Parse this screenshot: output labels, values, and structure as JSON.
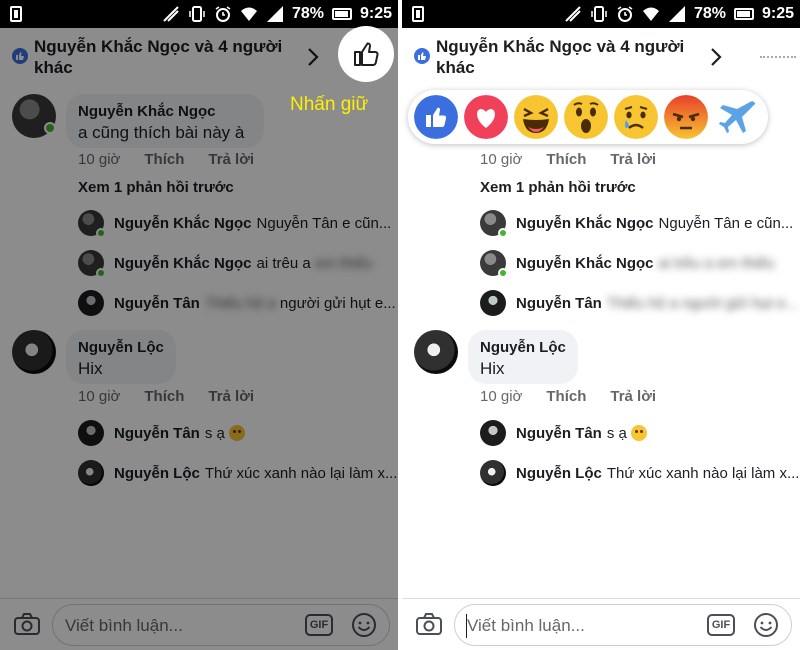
{
  "status_bar": {
    "battery": "78%",
    "time": "9:25"
  },
  "header": {
    "title": "Nguyễn Khắc Ngọc và 4 người khác"
  },
  "hint_label": "Nhấn giữ",
  "comments": [
    {
      "name": "Nguyễn Khắc Ngọc",
      "text": "a cũng thích bài này à",
      "time": "10 giờ",
      "like": "Thích",
      "reply": "Trả lời"
    },
    {
      "name": "Nguyễn Lộc",
      "text": "Hix",
      "time": "10 giờ",
      "like": "Thích",
      "reply": "Trả lời"
    }
  ],
  "view_previous": "Xem 1 phản hồi trước",
  "replies_group1": [
    {
      "name": "Nguyễn Khắc Ngọc",
      "text": "Nguyễn Tân e cũn..."
    },
    {
      "name": "Nguyễn Khắc Ngọc",
      "text": "ai trêu a",
      "blurred": "em thiếu"
    },
    {
      "name": "Nguyễn Tân",
      "text": "người gửi hụt e...",
      "blurred": "Thiếu hộ a"
    }
  ],
  "replies_group2": [
    {
      "name": "Nguyễn Tân",
      "text": "s ạ"
    },
    {
      "name": "Nguyễn Lộc",
      "text": "Thứ xúc xanh nào lại làm x..."
    }
  ],
  "right_replies": [
    {
      "name": "Nguyễn Khắc Ngọc",
      "text": "Nguyễn Tân e cũn...",
      "blurred": ""
    },
    {
      "name": "Nguyễn Khắc Ngọc",
      "text": "",
      "blurred": "ai trêu a em thiếu"
    },
    {
      "name": "Nguyễn Tân",
      "text": "",
      "blurred": "Thiếu hộ a người gửi hụt e..."
    }
  ],
  "composer": {
    "placeholder": "Viết bình luận...",
    "gif": "GIF"
  },
  "reactions": [
    "like",
    "love",
    "haha",
    "wow",
    "sad",
    "angry",
    "airplane"
  ]
}
